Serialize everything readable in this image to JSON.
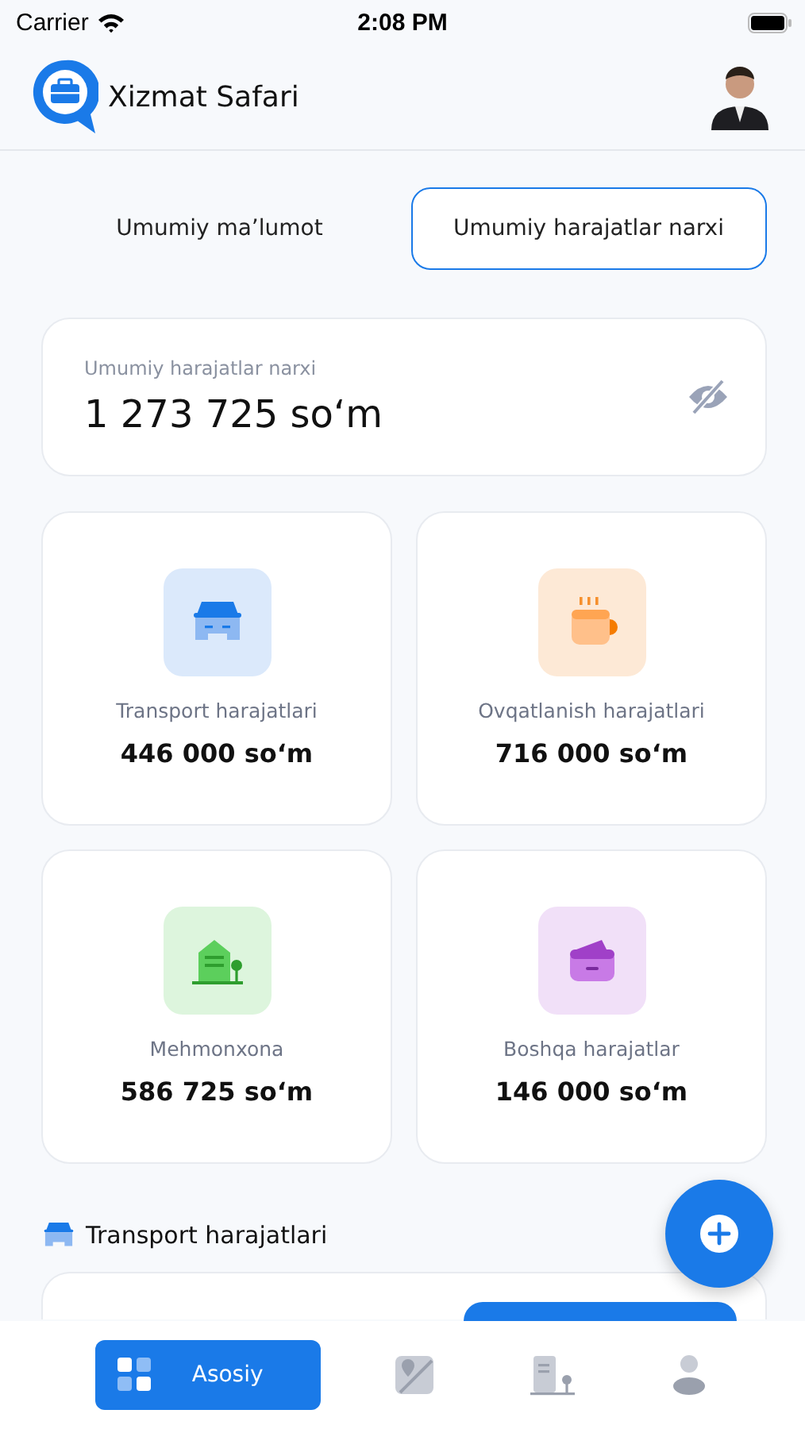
{
  "status_bar": {
    "carrier": "Carrier",
    "time": "2:08 PM"
  },
  "header": {
    "title": "Xizmat Safari"
  },
  "tabs": [
    {
      "label": "Umumiy maʼlumot",
      "selected": false
    },
    {
      "label": "Umumiy harajatlar narxi",
      "selected": true
    }
  ],
  "total": {
    "label": "Umumiy harajatlar narxi",
    "amount": "1 273 725 so‘m",
    "hidden": true
  },
  "categories": [
    {
      "kind": "car",
      "color": "#dbe9fb",
      "label": "Transport harajatlari",
      "amount": "446 000 so‘m"
    },
    {
      "kind": "cup",
      "color": "#fde9d6",
      "label": "Ovqatlanish harajatlari",
      "amount": "716 000 so‘m"
    },
    {
      "kind": "hotel",
      "color": "#ddf5dd",
      "label": "Mehmonxona",
      "amount": "586 725 so‘m"
    },
    {
      "kind": "wallet",
      "color": "#f1e0f8",
      "label": "Boshqa harajatlar",
      "amount": "146 000 so‘m"
    }
  ],
  "section": {
    "title": "Transport harajatlari"
  },
  "nav": [
    {
      "kind": "home",
      "label": "Asosiy",
      "selected": true
    },
    {
      "kind": "map",
      "selected": false
    },
    {
      "kind": "hotel",
      "selected": false
    },
    {
      "kind": "profile",
      "selected": false
    }
  ]
}
